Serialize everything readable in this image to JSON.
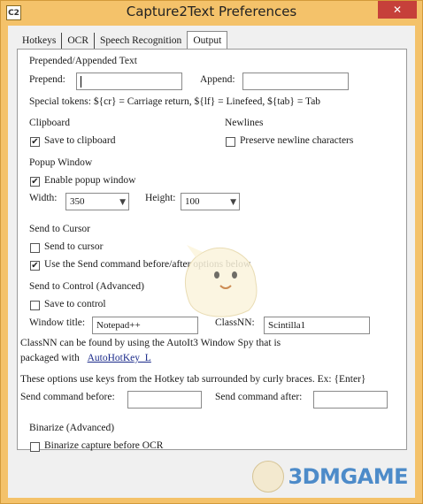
{
  "window": {
    "title": "Capture2Text Preferences",
    "icon_text": "C2",
    "close_glyph": "✕"
  },
  "tabs": [
    {
      "label": "Hotkeys"
    },
    {
      "label": "OCR"
    },
    {
      "label": "Speech Recognition"
    },
    {
      "label": "Output",
      "active": true
    }
  ],
  "prepended": {
    "heading": "Prepended/Appended Text",
    "prepend_label": "Prepend:",
    "prepend_value": "",
    "append_label": "Append:",
    "append_value": "",
    "special_tokens": "Special tokens: ${cr} = Carriage return, ${lf} = Linefeed, ${tab} = Tab"
  },
  "clipboard": {
    "heading": "Clipboard",
    "save_label": "Save to clipboard",
    "save_checked": true
  },
  "newlines": {
    "heading": "Newlines",
    "preserve_label": "Preserve newline characters",
    "preserve_checked": false
  },
  "popup": {
    "heading": "Popup Window",
    "enable_label": "Enable popup window",
    "enable_checked": true,
    "width_label": "Width:",
    "width_value": "350",
    "height_label": "Height:",
    "height_value": "100"
  },
  "send_cursor": {
    "heading": "Send to Cursor",
    "send_label": "Send to cursor",
    "send_checked": false,
    "use_send_label": "Use the Send command before/after options below",
    "use_send_checked": true
  },
  "send_control": {
    "heading": "Send to Control (Advanced)",
    "save_label": "Save to control",
    "save_checked": false,
    "window_title_label": "Window title:",
    "window_title_value": "Notepad++",
    "classnn_label": "ClassNN:",
    "classnn_value": "Scintilla1"
  },
  "classnn_note": {
    "line1": "ClassNN can be found by using the AutoIt3 Window Spy that is",
    "line2_prefix": "packaged with",
    "link": "AutoHotKey_L"
  },
  "send_commands": {
    "note": "These options use keys from the Hotkey tab surrounded by curly braces. Ex: {Enter}",
    "before_label": "Send command before:",
    "before_value": "",
    "after_label": "Send command after:",
    "after_value": ""
  },
  "binarize": {
    "heading": "Binarize (Advanced)",
    "label": "Binarize capture before OCR",
    "checked": false
  },
  "watermark": {
    "text": "3DMGAME"
  },
  "colors": {
    "frame": "#f4c26a",
    "close": "#c6403a",
    "link": "#1a2a8a",
    "watermark": "#4d8bc9"
  }
}
